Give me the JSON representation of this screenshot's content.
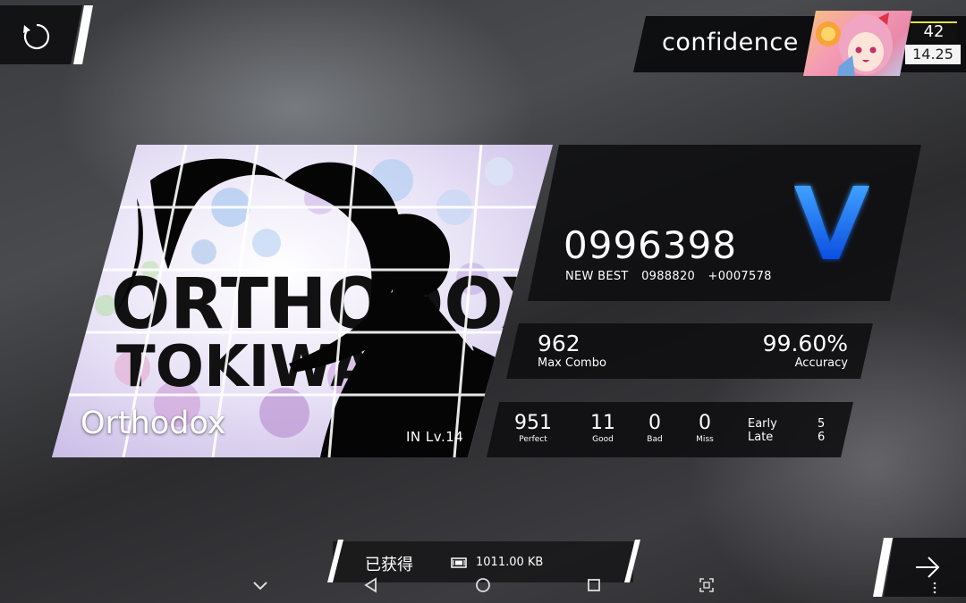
{
  "player": {
    "name": "confidence",
    "rank_level": "42",
    "rks": "14.25"
  },
  "song": {
    "cover_text_line1": "ORTHODOX",
    "cover_text_line2": "TOKIWA",
    "title": "Orthodox",
    "difficulty_level": "IN  Lv.14"
  },
  "result": {
    "score": "0996398",
    "new_best_label": "NEW BEST",
    "previous_best": "0988820",
    "score_delta": "+0007578",
    "grade": "V",
    "max_combo": "962",
    "max_combo_label": "Max Combo",
    "accuracy": "99.60%",
    "accuracy_label": "Accuracy"
  },
  "judgements": [
    {
      "value": "951",
      "label": "Perfect"
    },
    {
      "value": "11",
      "label": "Good"
    },
    {
      "value": "0",
      "label": "Bad"
    },
    {
      "value": "0",
      "label": "Miss"
    }
  ],
  "timing": {
    "early_label": "Early",
    "early_value": "5",
    "late_label": "Late",
    "late_value": "6"
  },
  "toast": {
    "text": "已获得",
    "icon": "data-chip-icon",
    "size": "1011.00 KB"
  },
  "colors": {
    "grade_blue": "#1e7bff",
    "rank_accent": "#d9e14a"
  },
  "icons": {
    "retry": "retry-icon",
    "next": "arrow-right-icon",
    "nav": [
      "chevron-down-icon",
      "back-icon",
      "home-icon",
      "recents-icon",
      "screenshot-icon"
    ]
  }
}
